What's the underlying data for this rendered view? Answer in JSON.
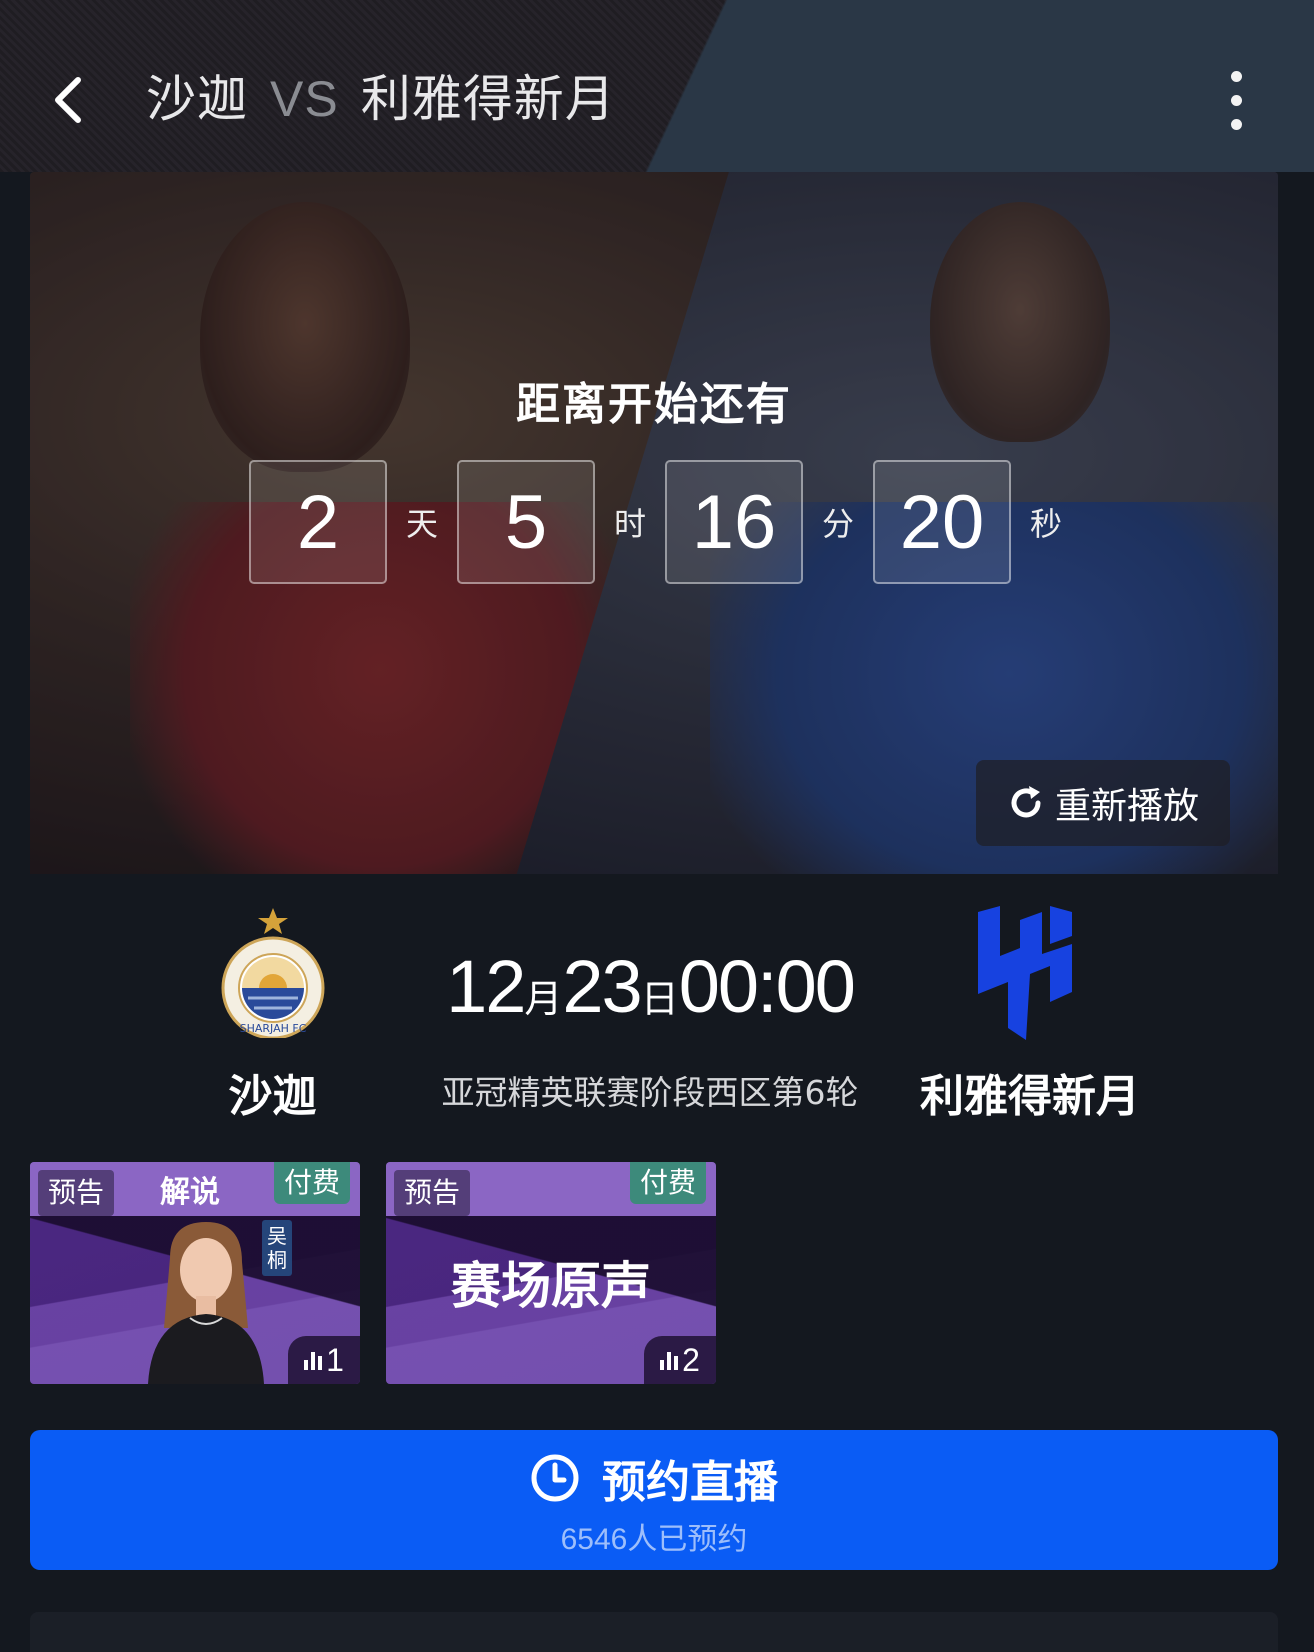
{
  "header": {
    "home_team": "沙迦",
    "vs": "VS",
    "away_team": "利雅得新月"
  },
  "hero": {
    "countdown_title": "距离开始还有",
    "countdown": [
      {
        "value": "2",
        "unit": "天"
      },
      {
        "value": "5",
        "unit": "时"
      },
      {
        "value": "16",
        "unit": "分"
      },
      {
        "value": "20",
        "unit": "秒"
      }
    ],
    "replay_label": "重新播放"
  },
  "match": {
    "home_name": "沙迦",
    "away_name": "利雅得新月",
    "month": "12",
    "month_unit": "月",
    "day": "23",
    "day_unit": "日",
    "time": "00:00",
    "league": "亚冠精英联赛阶段西区第6轮",
    "home_logo_text": "SHARJAH FC",
    "colors": {
      "away_logo": "#1742e0",
      "home_logo_gold": "#d4a23a",
      "home_logo_blue": "#2a4a9a"
    }
  },
  "channels": [
    {
      "preview": "预告",
      "label": "解说",
      "paid": "付费",
      "host": "吴桐",
      "rank": "1"
    },
    {
      "preview": "预告",
      "title": "赛场原声",
      "paid": "付费",
      "rank": "2"
    }
  ],
  "reserve": {
    "label": "预约直播",
    "count_text": "6546人已预约",
    "color": "#0a5cf5"
  }
}
